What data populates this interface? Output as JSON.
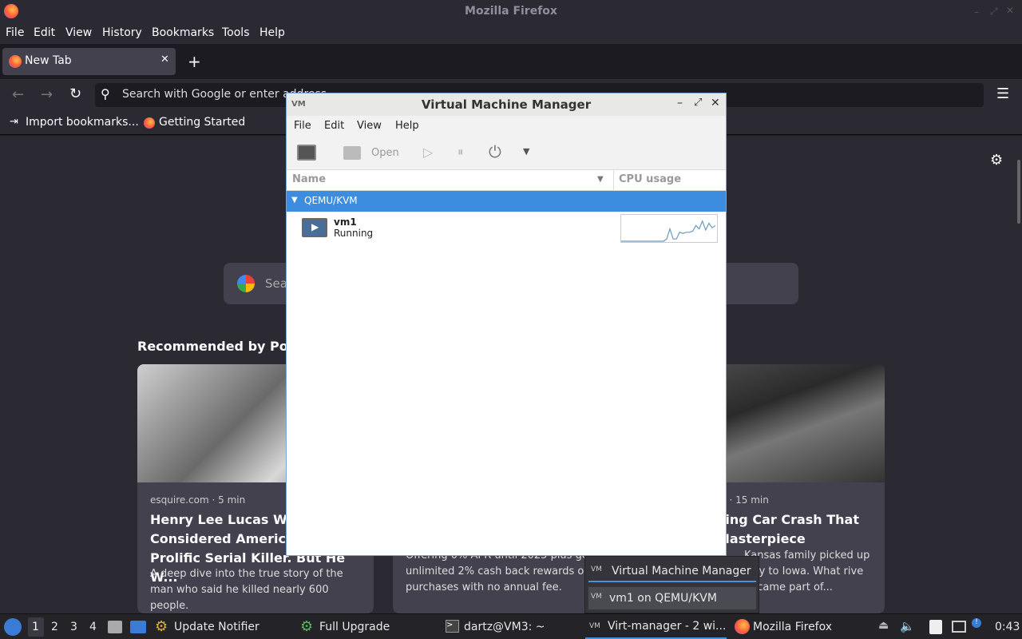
{
  "firefox": {
    "window_title": "Mozilla Firefox",
    "menu": [
      "File",
      "Edit",
      "View",
      "History",
      "Bookmarks",
      "Tools",
      "Help"
    ],
    "tab_title": "New Tab",
    "url_placeholder": "Search with Google or enter address",
    "bookmarks": [
      "Import bookmarks...",
      "Getting Started"
    ],
    "search_placeholder": "Search",
    "recommended_heading": "Recommended by Pocket",
    "cards": [
      {
        "source": "esquire.com · 5 min",
        "title": "Henry Lee Lucas Was Considered America's Most Prolific Serial Killer. But He W...",
        "desc": "A deep dive into the true story of the man who said he killed nearly 600 people."
      },
      {
        "source": "",
        "title": "",
        "desc": "Offering 0% APR until 2025 plus get unlimited 2% cash back rewards on purchases with no annual fee."
      },
      {
        "source": "m · 15 min",
        "title": "ying Car Crash That Masterpiece",
        "desc": "Kansas family picked up way to Iowa. What rive became part of..."
      }
    ]
  },
  "vmm": {
    "title": "Virtual Machine Manager",
    "menu": [
      "File",
      "Edit",
      "View",
      "Help"
    ],
    "toolbar_open": "Open",
    "col_name": "Name",
    "col_cpu": "CPU usage",
    "group": "QEMU/KVM",
    "vm_name": "vm1",
    "vm_status": "Running",
    "cpu_graph": [
      0,
      0,
      0,
      0,
      0,
      0,
      0,
      0,
      0,
      0,
      0,
      0,
      0,
      0,
      0.1,
      0.55,
      0.1,
      0.1,
      0.4,
      0.35,
      0.4,
      0.4,
      0.45,
      0.7,
      0.55,
      0.9,
      0.5,
      0.8,
      0.6,
      0.7
    ]
  },
  "popup": {
    "items": [
      "Virtual Machine Manager",
      "vm1 on QEMU/KVM"
    ]
  },
  "taskbar": {
    "workspaces": [
      "1",
      "2",
      "3",
      "4"
    ],
    "items": [
      "Update Notifier",
      "Full Upgrade",
      "dartz@VM3: ~",
      "Virt-manager - 2 wi...",
      "Mozilla Firefox"
    ],
    "clock": "0:43"
  }
}
